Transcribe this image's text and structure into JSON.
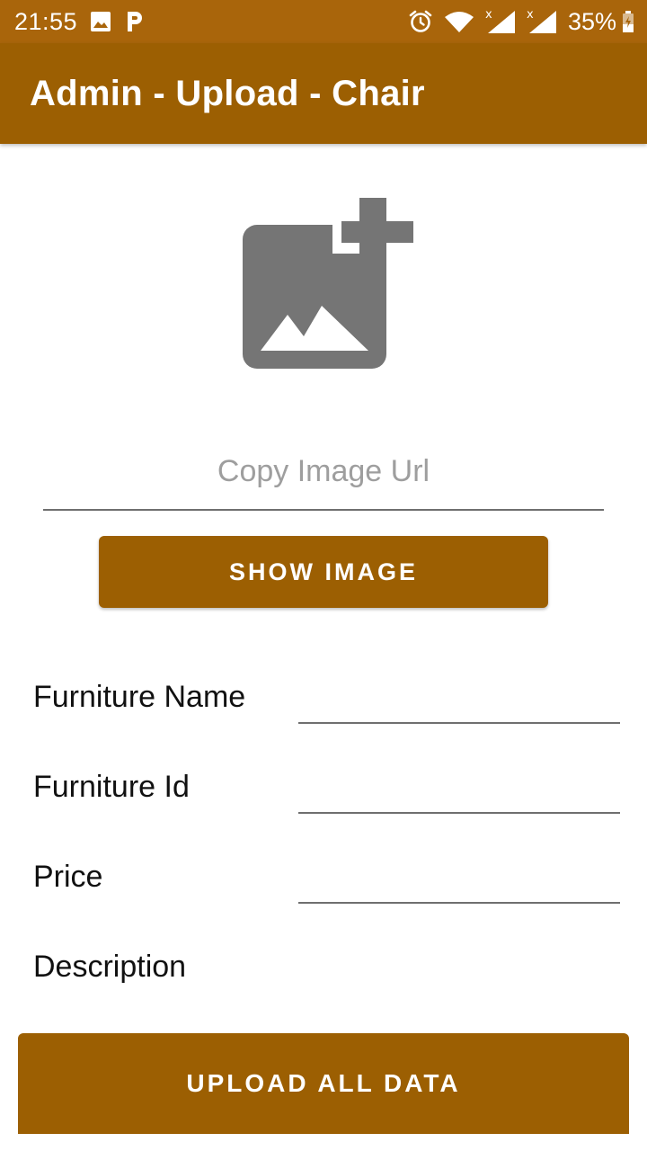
{
  "status_bar": {
    "time": "21:55",
    "battery": "35%",
    "icons": [
      "image-icon",
      "p-icon",
      "alarm-icon",
      "wifi-icon",
      "signal-icon",
      "signal-icon",
      "battery-icon"
    ]
  },
  "app_bar": {
    "title": "Admin - Upload - Chair"
  },
  "image_picker": {
    "icon": "add-photo-icon"
  },
  "url_field": {
    "placeholder": "Copy Image Url",
    "value": ""
  },
  "show_image_button": {
    "label": "SHOW IMAGE"
  },
  "form": {
    "furniture_name": {
      "label": "Furniture Name",
      "value": ""
    },
    "furniture_id": {
      "label": "Furniture Id",
      "value": ""
    },
    "price": {
      "label": "Price",
      "value": ""
    },
    "description": {
      "label": "Description"
    }
  },
  "upload_button": {
    "label": "UPLOAD ALL DATA"
  },
  "colors": {
    "status_bar": "#a9650b",
    "primary": "#9c5f02",
    "icon_gray": "#757575"
  }
}
